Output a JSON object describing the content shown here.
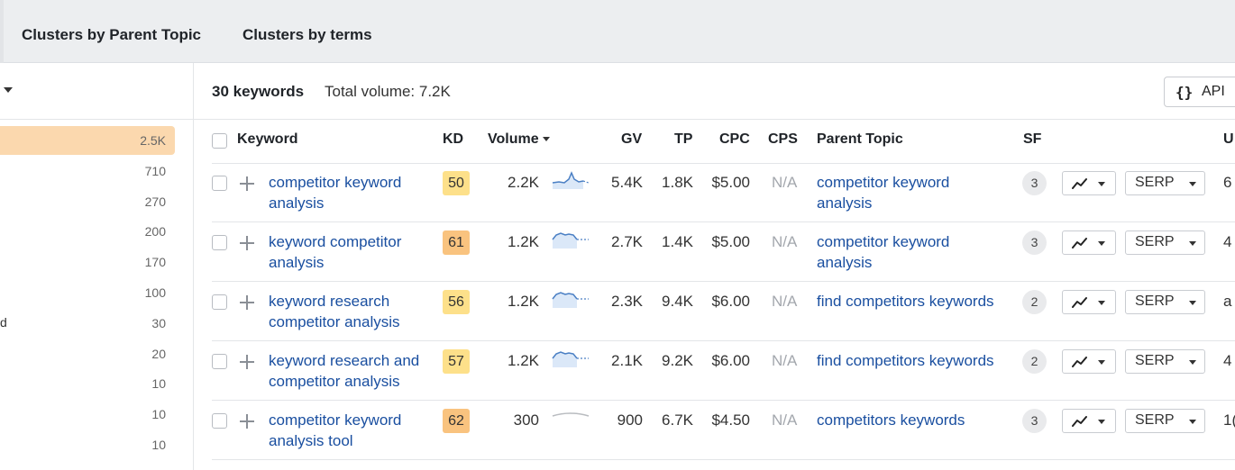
{
  "tabs": [
    "Clusters by Parent Topic",
    "Clusters by terms"
  ],
  "sidebar": {
    "rows": [
      {
        "value": "2.5K",
        "active": true,
        "label": ""
      },
      {
        "value": "710",
        "label": ""
      },
      {
        "value": "270",
        "label": ""
      },
      {
        "value": "200",
        "label": ""
      },
      {
        "value": "170",
        "label": ""
      },
      {
        "value": "100",
        "label": ""
      },
      {
        "value": "30",
        "label": "d"
      },
      {
        "value": "20",
        "label": ""
      },
      {
        "value": "10",
        "label": ""
      },
      {
        "value": "10",
        "label": ""
      },
      {
        "value": "10",
        "label": ""
      }
    ]
  },
  "header": {
    "keyword_count": "30 keywords",
    "total_volume": "Total volume: 7.2K",
    "api_braces": "{}",
    "api_label": "API"
  },
  "columns": {
    "keyword": "Keyword",
    "kd": "KD",
    "volume": "Volume",
    "gv": "GV",
    "tp": "TP",
    "cpc": "CPC",
    "cps": "CPS",
    "parent_topic": "Parent Topic",
    "sf": "SF",
    "u": "U"
  },
  "rows": [
    {
      "keyword_l1": "competitor keyword",
      "keyword_l2": "analysis",
      "kd": "50",
      "kd_color": "#fde08a",
      "volume": "2.2K",
      "gv": "5.4K",
      "tp": "1.8K",
      "cpc": "$5.00",
      "cps": "N/A",
      "pt_l1": "competitor keyword",
      "pt_l2": "analysis",
      "sf": "3",
      "serp": "SERP",
      "u": "6",
      "spark": "peak"
    },
    {
      "keyword_l1": "keyword competitor",
      "keyword_l2": "analysis",
      "kd": "61",
      "kd_color": "#f9c37f",
      "volume": "1.2K",
      "gv": "2.7K",
      "tp": "1.4K",
      "cpc": "$5.00",
      "cps": "N/A",
      "pt_l1": "competitor keyword",
      "pt_l2": "analysis",
      "sf": "3",
      "serp": "SERP",
      "u": "4",
      "spark": "hump"
    },
    {
      "keyword_l1": "keyword research",
      "keyword_l2": "competitor analysis",
      "kd": "56",
      "kd_color": "#fde08a",
      "volume": "1.2K",
      "gv": "2.3K",
      "tp": "9.4K",
      "cpc": "$6.00",
      "cps": "N/A",
      "pt_l1": "find competitors keywords",
      "pt_l2": "",
      "sf": "2",
      "serp": "SERP",
      "u": "a",
      "spark": "hump"
    },
    {
      "keyword_l1": "keyword research and",
      "keyword_l2": "competitor analysis",
      "kd": "57",
      "kd_color": "#fde08a",
      "volume": "1.2K",
      "gv": "2.1K",
      "tp": "9.2K",
      "cpc": "$6.00",
      "cps": "N/A",
      "pt_l1": "find competitors keywords",
      "pt_l2": "",
      "sf": "2",
      "serp": "SERP",
      "u": "4",
      "spark": "hump"
    },
    {
      "keyword_l1": "competitor keyword",
      "keyword_l2": "analysis tool",
      "kd": "62",
      "kd_color": "#f9c37f",
      "volume": "300",
      "gv": "900",
      "tp": "6.7K",
      "cpc": "$4.50",
      "cps": "N/A",
      "pt_l1": "competitors keywords",
      "pt_l2": "",
      "sf": "3",
      "serp": "SERP",
      "u": "1(",
      "spark": "flat"
    }
  ]
}
